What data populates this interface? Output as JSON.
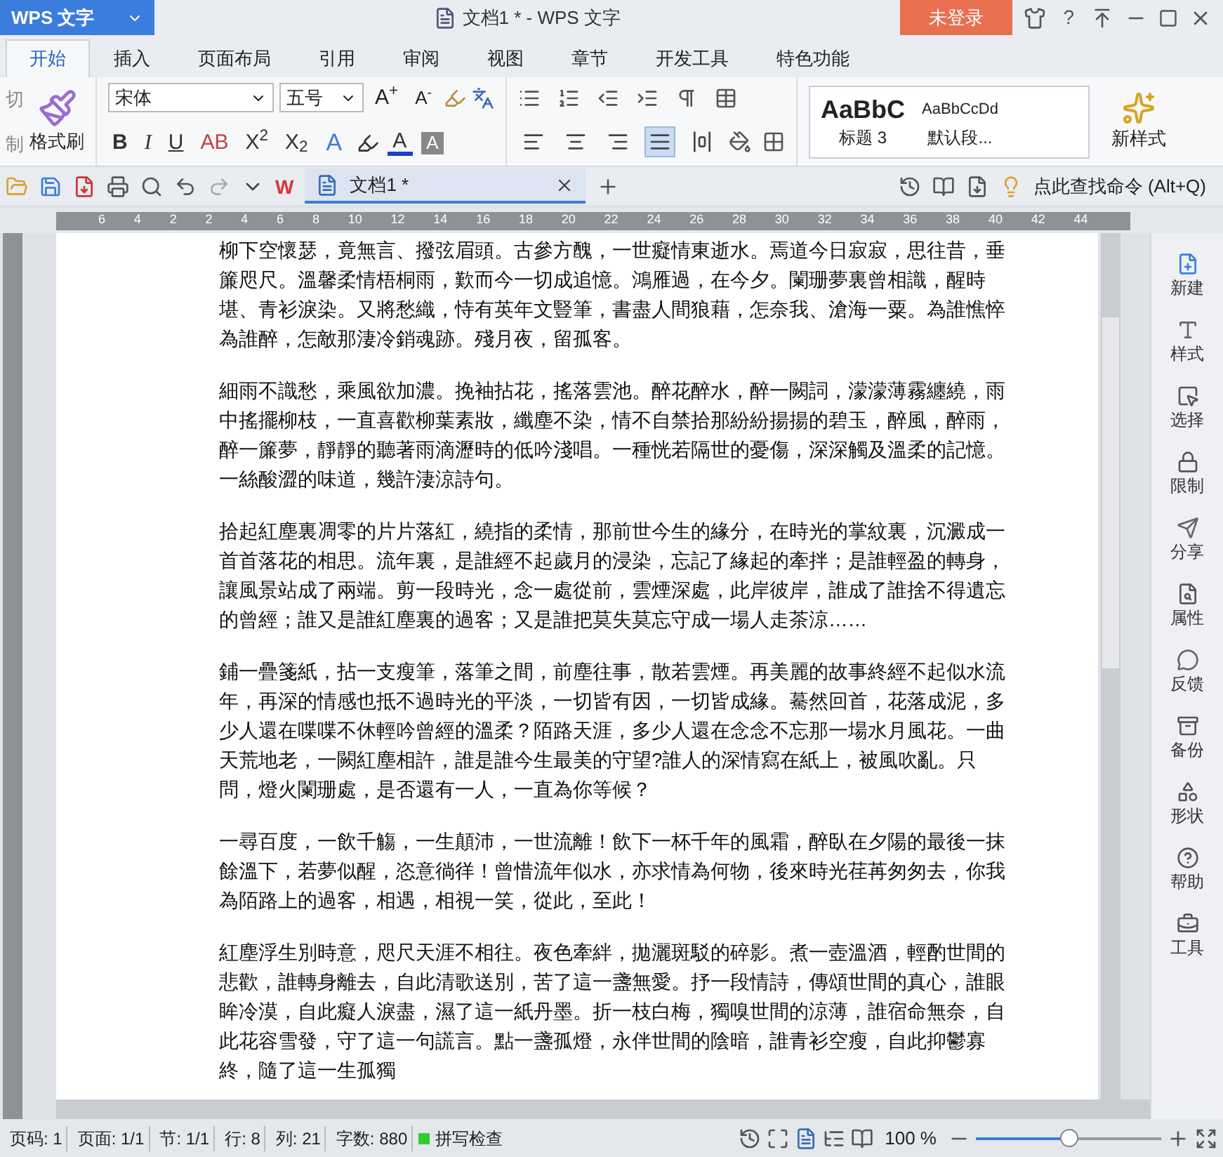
{
  "app_button": {
    "label": "WPS 文字"
  },
  "window": {
    "title": "文档1 * - WPS 文字",
    "login": "未登录",
    "help": "?"
  },
  "tabs": [
    {
      "label": "开始",
      "selected": true
    },
    {
      "label": "插入",
      "selected": false
    },
    {
      "label": "页面布局",
      "selected": false
    },
    {
      "label": "引用",
      "selected": false
    },
    {
      "label": "审阅",
      "selected": false
    },
    {
      "label": "视图",
      "selected": false
    },
    {
      "label": "章节",
      "selected": false
    },
    {
      "label": "开发工具",
      "selected": false
    },
    {
      "label": "特色功能",
      "selected": false
    }
  ],
  "ribbon": {
    "clipboard": [
      "切",
      "制"
    ],
    "format_painter": "格式刷",
    "font": "宋体",
    "size": "五号",
    "grow": "A$^{+}$",
    "shrink": "A$^{-}$",
    "format_buttons": [
      "B",
      "I",
      "U",
      "AB",
      "X$^{2}$",
      "X$_{2}$"
    ],
    "text_effect": "A",
    "font_color": "A",
    "shade": "A",
    "align": [
      {
        "selected": false
      },
      {
        "selected": false
      },
      {
        "selected": false
      },
      {
        "selected": true
      },
      {
        "selected": false
      }
    ],
    "styles": [
      {
        "sample": "AaBbC",
        "name": "标题 3",
        "kind": "heading"
      },
      {
        "sample": "AaBbCcDd",
        "name": "默认段...",
        "kind": "body"
      }
    ],
    "new_style": "新样式"
  },
  "doc_tab": {
    "logo": "W",
    "title": "文档1 *"
  },
  "command_search": "点此查找命令 (Alt+Q)",
  "ruler": [
    "6",
    "4",
    "2",
    "2",
    "4",
    "6",
    "8",
    "10",
    "12",
    "14",
    "16",
    "18",
    "20",
    "22",
    "24",
    "26",
    "28",
    "30",
    "32",
    "34",
    "36",
    "38",
    "40",
    "42",
    "44"
  ],
  "paragraphs": [
    "柳下空懷瑟，竟無言、撥弦眉頭。古參方醜，一世癡情東逝水。焉道今日寂寂，思往昔，垂簾咫尺。溫馨柔情梧桐雨，歎而今一切成追憶。鴻雁過，在今夕。闌珊夢裏曾相識，醒時堪、青衫淚染。又將愁織，恃有英年文豎筆，書盡人間狼藉，怎奈我、滄海一粟。為誰憔悴為誰醉，怎敵那淒冷銷魂跡。殘月夜，留孤客。",
    "細雨不識愁，乘風欲加濃。挽袖拈花，搖落雲池。醉花醉水，醉一闕詞，濛濛薄霧纏繞，雨中搖擺柳枝，一直喜歡柳葉素妝，纖塵不染，情不自禁拾那紛紛揚揚的碧玉，醉風，醉雨，醉一簾夢，靜靜的聽著雨滴瀝時的低吟淺唱。一種恍若隔世的憂傷，深深觸及溫柔的記憶。一絲酸澀的味道，幾許淒涼詩句。",
    "拾起紅塵裏凋零的片片落紅，繞指的柔情，那前世今生的緣分，在時光的掌紋裏，沉澱成一首首落花的相思。流年裏，是誰經不起歲月的浸染，忘記了緣起的牽拌；是誰輕盈的轉身，讓風景站成了兩端。剪一段時光，念一處從前，雲煙深處，此岸彼岸，誰成了誰捨不得遺忘的曾經；誰又是誰紅塵裏的過客；又是誰把莫失莫忘守成一場人走茶涼……",
    "鋪一疊箋紙，拈一支瘦筆，落筆之間，前塵往事，散若雲煙。再美麗的故事終經不起似水流年，再深的情感也抵不過時光的平淡，一切皆有因，一切皆成緣。驀然回首，花落成泥，多少人還在喋喋不休輕吟曾經的溫柔？陌路天涯，多少人還在念念不忘那一場水月風花。一曲天荒地老，一闕紅塵相許，誰是誰今生最美的守望?誰人的深情寫在紙上，被風吹亂。只問，燈火闌珊處，是否還有一人，一直為你等候？",
    "一尋百度，一飲千觴，一生顛沛，一世流離！飲下一杯千年的風霜，醉臥在夕陽的最後一抹餘溫下，若夢似醒，恣意徜徉！曾惜流年似水，亦求情為何物，後來時光荏苒匆匆去，你我為陌路上的過客，相遇，相視一笑，從此，至此！",
    "紅塵浮生別時意，咫尺天涯不相往。夜色牽絆，拋灑斑駁的碎影。煮一壺溫酒，輕酌世間的悲歡，誰轉身離去，自此清歌送別，苦了這一盞無愛。抒一段情詩，傳頌世間的真心，誰眼眸冷漠，自此癡人淚盡，濕了這一紙丹墨。折一枝白梅，獨嗅世間的涼薄，誰宿命無奈，自此花容雪發，守了這一句謊言。點一盞孤燈，永伴世間的陰暗，誰青衫空瘦，自此抑鬱寡終，隨了這一生孤獨"
  ],
  "sidebar": [
    {
      "label": "新建",
      "kind": "new"
    },
    {
      "label": "样式",
      "kind": "style"
    },
    {
      "label": "选择",
      "kind": "select"
    },
    {
      "label": "限制",
      "kind": "lock"
    },
    {
      "label": "分享",
      "kind": "share"
    },
    {
      "label": "属性",
      "kind": "props"
    },
    {
      "label": "反馈",
      "kind": "feedback"
    },
    {
      "label": "备份",
      "kind": "backup"
    },
    {
      "label": "形状",
      "kind": "shape"
    },
    {
      "label": "帮助",
      "kind": "help"
    },
    {
      "label": "工具",
      "kind": "tools"
    }
  ],
  "status_bar": {
    "fields": [
      "页码: 1",
      "页面: 1/1",
      "节: 1/1",
      "行: 8",
      "列: 21",
      "字数: 880"
    ],
    "spell_check": "拼写检查",
    "zoom": "100 %",
    "zoom_slider": {
      "level": 0.5
    }
  }
}
